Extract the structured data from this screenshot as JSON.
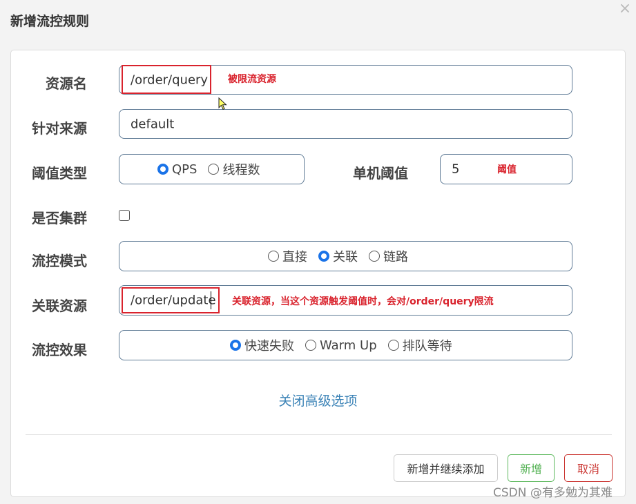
{
  "dialog": {
    "title": "新增流控规则",
    "close_symbol": "×"
  },
  "form": {
    "resource": {
      "label": "资源名",
      "value": "/order/query",
      "annotation": "被限流资源"
    },
    "limit_app": {
      "label": "针对来源",
      "value": "default"
    },
    "threshold_type": {
      "label": "阈值类型",
      "options": [
        {
          "label": "QPS",
          "selected": true
        },
        {
          "label": "线程数",
          "selected": false
        }
      ]
    },
    "single_threshold": {
      "label": "单机阈值",
      "value": "5",
      "annotation": "阈值"
    },
    "cluster": {
      "label": "是否集群",
      "checked": false
    },
    "strategy": {
      "label": "流控模式",
      "options": [
        {
          "label": "直接",
          "selected": false
        },
        {
          "label": "关联",
          "selected": true
        },
        {
          "label": "链路",
          "selected": false
        }
      ]
    },
    "ref_resource": {
      "label": "关联资源",
      "value": "/order/update",
      "annotation": "关联资源，当这个资源触发阈值时，会对/order/query限流"
    },
    "control_behavior": {
      "label": "流控效果",
      "options": [
        {
          "label": "快速失败",
          "selected": true
        },
        {
          "label": "Warm Up",
          "selected": false
        },
        {
          "label": "排队等待",
          "selected": false
        }
      ]
    }
  },
  "advanced_link": "关闭高级选项",
  "buttons": {
    "add_continue": "新增并继续添加",
    "add": "新增",
    "cancel": "取消"
  },
  "colors": {
    "accent": "#1a73e8",
    "annotation_red": "#d9232d",
    "link_blue": "#3a82b6",
    "success_green": "#5cb85c",
    "danger_red": "#c9302c"
  },
  "watermark": "CSDN @有多勉为其难"
}
